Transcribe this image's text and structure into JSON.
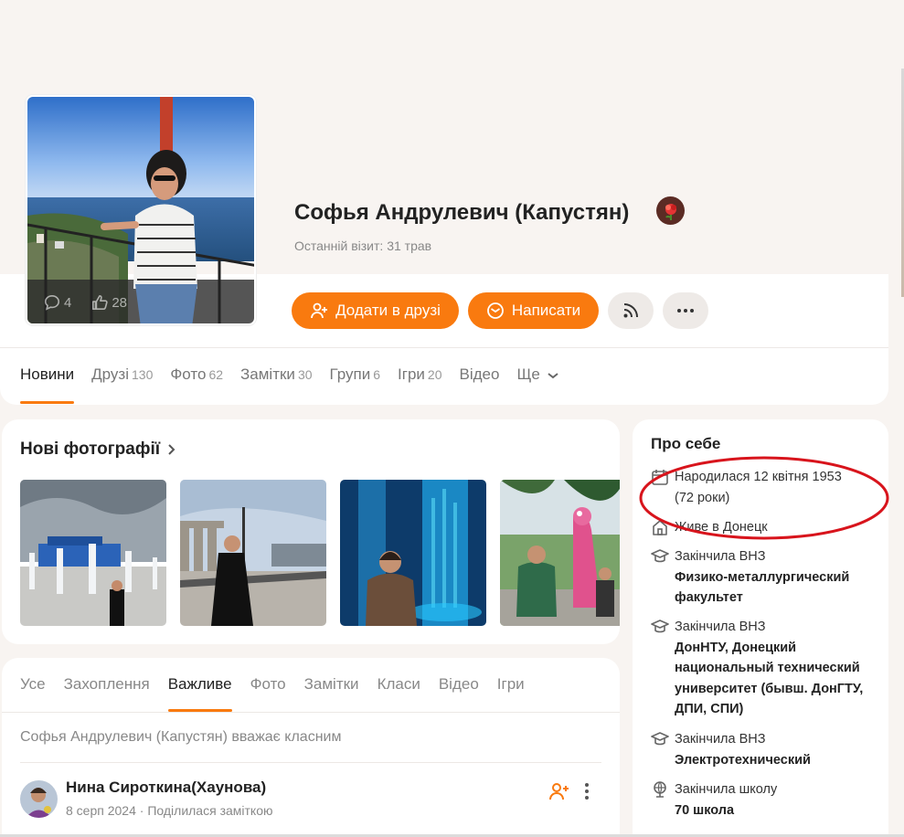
{
  "profile": {
    "name": "Софья Андрулевич (Капустян)",
    "last_visit": "Останній візит: 31 трав",
    "avatar_comments": "4",
    "avatar_likes": "28"
  },
  "actions": {
    "add_friend": "Додати в друзі",
    "write": "Написати"
  },
  "main_tabs": [
    {
      "label": "Новини",
      "count": ""
    },
    {
      "label": "Друзі",
      "count": "130"
    },
    {
      "label": "Фото",
      "count": "62"
    },
    {
      "label": "Замітки",
      "count": "30"
    },
    {
      "label": "Групи",
      "count": "6"
    },
    {
      "label": "Ігри",
      "count": "20"
    },
    {
      "label": "Відео",
      "count": ""
    },
    {
      "label": "Ще",
      "count": ""
    }
  ],
  "photos": {
    "title": "Нові фотографії"
  },
  "feed": {
    "tabs": [
      "Усе",
      "Захоплення",
      "Важливе",
      "Фото",
      "Замітки",
      "Класи",
      "Відео",
      "Ігри"
    ],
    "note": "Софья Андрулевич (Капустян) вважає класним",
    "post": {
      "author": "Нина Сироткина(Хаунова)",
      "date": "8 серп 2024",
      "separator": "·",
      "action": "Поділилася заміткою"
    }
  },
  "about": {
    "title": "Про себе",
    "born_line1": "Народилася 12 квітня 1953",
    "born_line2": "(72 роки)",
    "lives": "Живе в Донецк",
    "edu1_label": "Закінчила ВНЗ",
    "edu1_value": "Физико-металлургический факультет",
    "edu2_label": "Закінчила ВНЗ",
    "edu2_value": "ДонНТУ, Донецкий национальный технический университет (бывш. ДонГТУ, ДПИ, СПИ)",
    "edu3_label": "Закінчила ВНЗ",
    "edu3_value": "Электротехнический",
    "school_label": "Закінчила школу",
    "school_value": "70 школа"
  },
  "colors": {
    "accent": "#f97a0f",
    "page_bg": "#f8f4f1",
    "annotation": "#d8141c"
  }
}
